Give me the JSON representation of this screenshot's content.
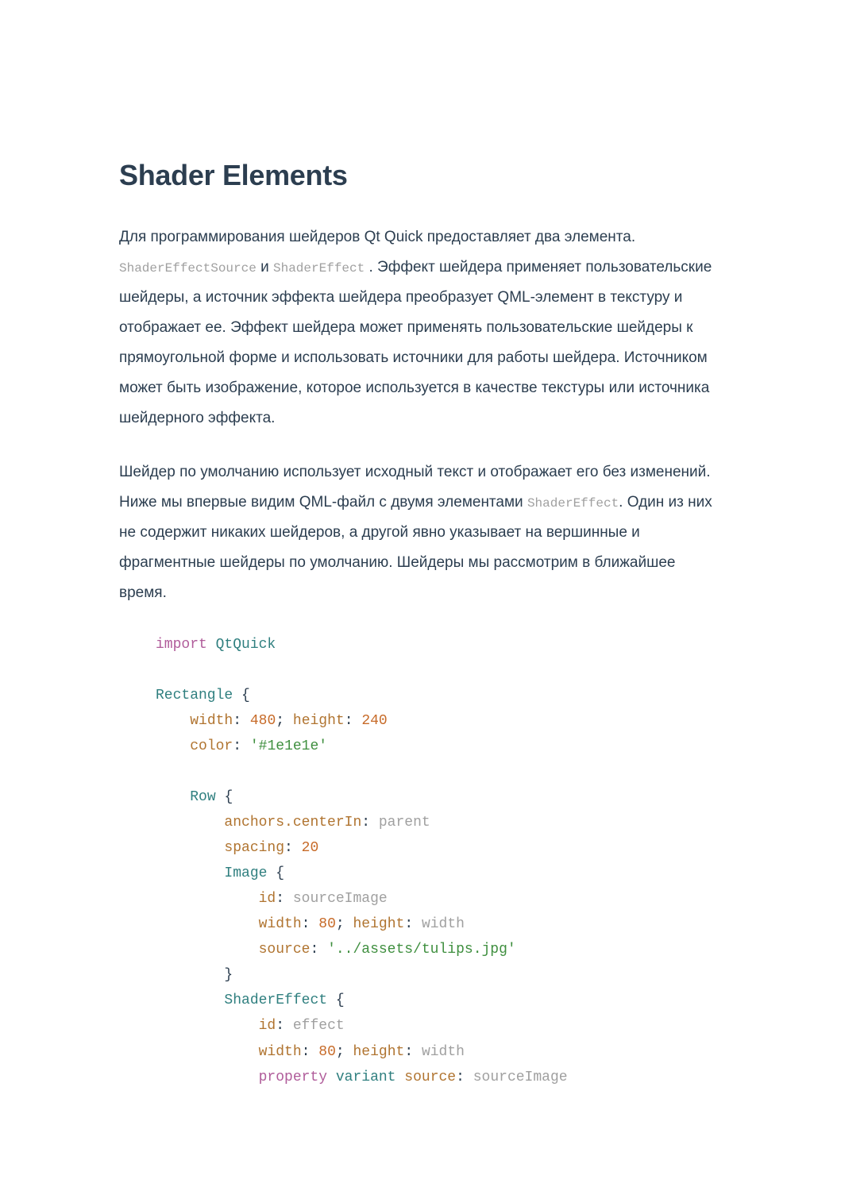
{
  "title": "Shader Elements",
  "para1": {
    "t1": "Для программирования шейдеров Qt Quick предоставляет два элемента. ",
    "code1": "ShaderEffectSource",
    "t2": " и ",
    "code2": "ShaderEffect",
    "t3": " . Эффект шейдера применяет пользовательские шейдеры, а источник эффекта шейдера преобразует QML-элемент в текстуру и отображает ее. Эффект шейдера может применять пользовательские шейдеры к прямоугольной форме и использовать источники для работы шейдера. Источником может быть изображение, которое используется в качестве текстуры или источника шейдерного эффекта."
  },
  "para2": {
    "t1": "Шейдер по умолчанию использует исходный текст и отображает его без изменений. Ниже мы впервые видим QML-файл с двумя элементами ",
    "code1": "ShaderEffect",
    "t2": ". Один из них не содержит никаких шейдеров, а другой явно указывает на вершинные и фрагментные шейдеры по умолчанию. Шейдеры мы рассмотрим в ближайшее время."
  },
  "code": {
    "import": "import",
    "QtQuick": "QtQuick",
    "Rectangle": "Rectangle",
    "lbrace": "{",
    "rbrace": "}",
    "width": "width",
    "colon": ":",
    "semi": ";",
    "n480": "480",
    "height": "height",
    "n240": "240",
    "color": "color",
    "colorVal": "'#1e1e1e'",
    "Row": "Row",
    "anchorsCenterIn": "anchors.centerIn",
    "parent": "parent",
    "spacing": "spacing",
    "n20": "20",
    "Image": "Image",
    "id": "id",
    "sourceImage": "sourceImage",
    "n80": "80",
    "widthRef": "width",
    "source": "source",
    "sourceVal": "'../assets/tulips.jpg'",
    "ShaderEffect": "ShaderEffect",
    "effect": "effect",
    "property": "property",
    "variant": "variant"
  }
}
